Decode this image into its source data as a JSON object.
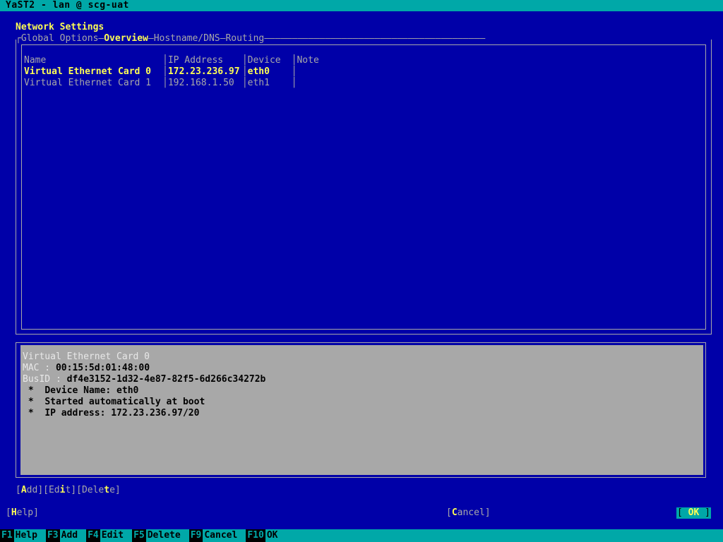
{
  "window": {
    "titlebar": "YaST2 - lan @ scg-uat"
  },
  "page": {
    "heading": "Network Settings"
  },
  "tabs": {
    "items": [
      {
        "label": "Global Options",
        "active": false
      },
      {
        "label": "Overview",
        "active": true
      },
      {
        "label": "Hostname/DNS",
        "active": false
      },
      {
        "label": "Routing",
        "active": false
      }
    ],
    "separator": "—"
  },
  "table": {
    "columns": [
      "Name",
      "IP Address",
      "Device",
      "Note"
    ],
    "rows": [
      {
        "selected": true,
        "name": "Virtual Ethernet Card 0",
        "ip": "172.23.236.97",
        "device": "eth0",
        "note": ""
      },
      {
        "selected": false,
        "name": "Virtual Ethernet Card 1",
        "ip": "192.168.1.50",
        "device": "eth1",
        "note": ""
      }
    ]
  },
  "detail": {
    "title": "Virtual Ethernet Card 0",
    "mac_label": "MAC",
    "mac_value": "00:15:5d:01:48:00",
    "busid_label": "BusID",
    "busid_value": "df4e3152-1d32-4e87-82f5-6d266c34272b",
    "bullet": "*",
    "items": [
      "Device Name: eth0",
      "Started automatically at boot",
      "IP address: 172.23.236.97/20"
    ]
  },
  "actions": {
    "add": {
      "pre": "",
      "hotkey": "A",
      "post": "dd"
    },
    "edit": {
      "pre": "Ed",
      "hotkey": "i",
      "post": "t"
    },
    "delete": {
      "pre": "Dele",
      "hotkey": "t",
      "post": "e"
    }
  },
  "dialog_buttons": {
    "help": {
      "pre": "",
      "hotkey": "H",
      "post": "elp"
    },
    "cancel": {
      "pre": "",
      "hotkey": "C",
      "post": "ancel"
    },
    "ok": {
      "text": "OK"
    }
  },
  "fkeys": [
    {
      "key": "F1",
      "label": "Help"
    },
    {
      "key": "F3",
      "label": "Add"
    },
    {
      "key": "F4",
      "label": "Edit"
    },
    {
      "key": "F5",
      "label": "Delete"
    },
    {
      "key": "F9",
      "label": "Cancel"
    },
    {
      "key": "F10",
      "label": "OK"
    }
  ],
  "colors": {
    "background": "#0000a8",
    "accent_teal": "#00a8a8",
    "highlight_yellow": "#fefe54",
    "text_grey": "#a8a8a8",
    "panel_grey": "#a8a8a8"
  }
}
